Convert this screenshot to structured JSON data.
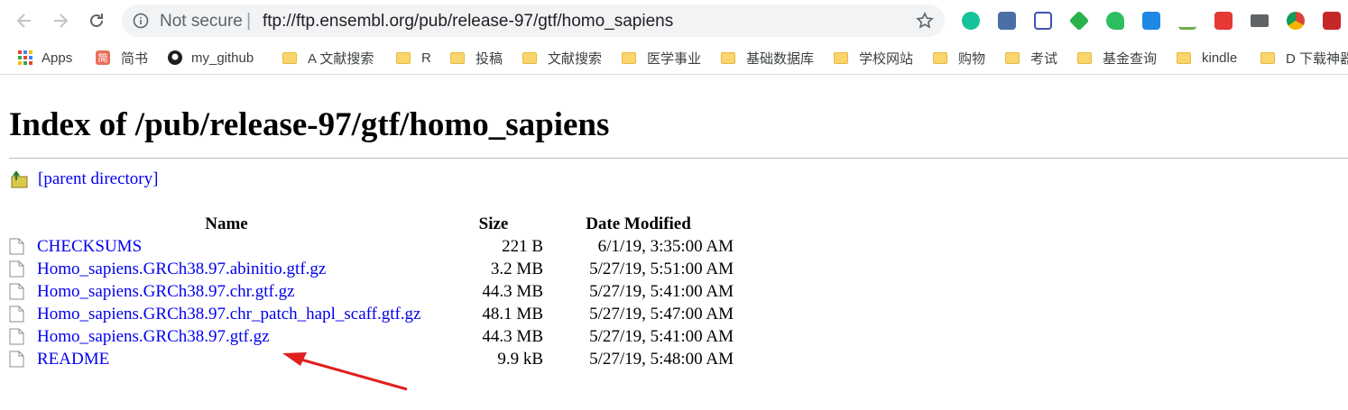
{
  "browser": {
    "omnibox": {
      "security_label": "Not secure",
      "separator": "|",
      "url": "ftp://ftp.ensembl.org/pub/release-97/gtf/homo_sapiens"
    },
    "bookmarks": [
      {
        "label": "Apps",
        "icon": "apps-grid-icon"
      },
      {
        "label": "简书",
        "icon": "jianshu-icon"
      },
      {
        "label": "my_github",
        "icon": "github-icon"
      },
      {
        "label": "A 文献搜索",
        "icon": "folder-icon"
      },
      {
        "label": "R",
        "icon": "folder-icon"
      },
      {
        "label": "投稿",
        "icon": "folder-icon"
      },
      {
        "label": "文献搜索",
        "icon": "folder-icon"
      },
      {
        "label": "医学事业",
        "icon": "folder-icon"
      },
      {
        "label": "基础数据库",
        "icon": "folder-icon"
      },
      {
        "label": "学校网站",
        "icon": "folder-icon"
      },
      {
        "label": "购物",
        "icon": "folder-icon"
      },
      {
        "label": "考试",
        "icon": "folder-icon"
      },
      {
        "label": "基金查询",
        "icon": "folder-icon"
      },
      {
        "label": "kindle",
        "icon": "folder-icon"
      },
      {
        "label": "D 下载神器",
        "icon": "folder-icon"
      }
    ],
    "jianshu_glyph": "简",
    "extensions": [
      "grammarly-icon",
      "rss-icon",
      "science-icon",
      "feedly-icon",
      "evernote-icon",
      "note-icon",
      "check-icon",
      "text-icon",
      "mail-icon",
      "chrome-icon",
      "tasks-icon"
    ]
  },
  "page": {
    "title": "Index of /pub/release-97/gtf/homo_sapiens",
    "parent_link": "[parent directory]",
    "table": {
      "headers": {
        "name": "Name",
        "size": "Size",
        "date": "Date Modified"
      },
      "rows": [
        {
          "name": "CHECKSUMS",
          "size": "221 B",
          "date": "6/1/19, 3:35:00 AM"
        },
        {
          "name": "Homo_sapiens.GRCh38.97.abinitio.gtf.gz",
          "size": "3.2 MB",
          "date": "5/27/19, 5:51:00 AM"
        },
        {
          "name": "Homo_sapiens.GRCh38.97.chr.gtf.gz",
          "size": "44.3 MB",
          "date": "5/27/19, 5:41:00 AM"
        },
        {
          "name": "Homo_sapiens.GRCh38.97.chr_patch_hapl_scaff.gtf.gz",
          "size": "48.1 MB",
          "date": "5/27/19, 5:47:00 AM"
        },
        {
          "name": "Homo_sapiens.GRCh38.97.gtf.gz",
          "size": "44.3 MB",
          "date": "5/27/19, 5:41:00 AM"
        },
        {
          "name": "README",
          "size": "9.9 kB",
          "date": "5/27/19, 5:48:00 AM"
        }
      ]
    }
  },
  "colors": {
    "link": "#0000ee",
    "annotation_arrow": "#e02020",
    "folder": "#f9d56e"
  }
}
